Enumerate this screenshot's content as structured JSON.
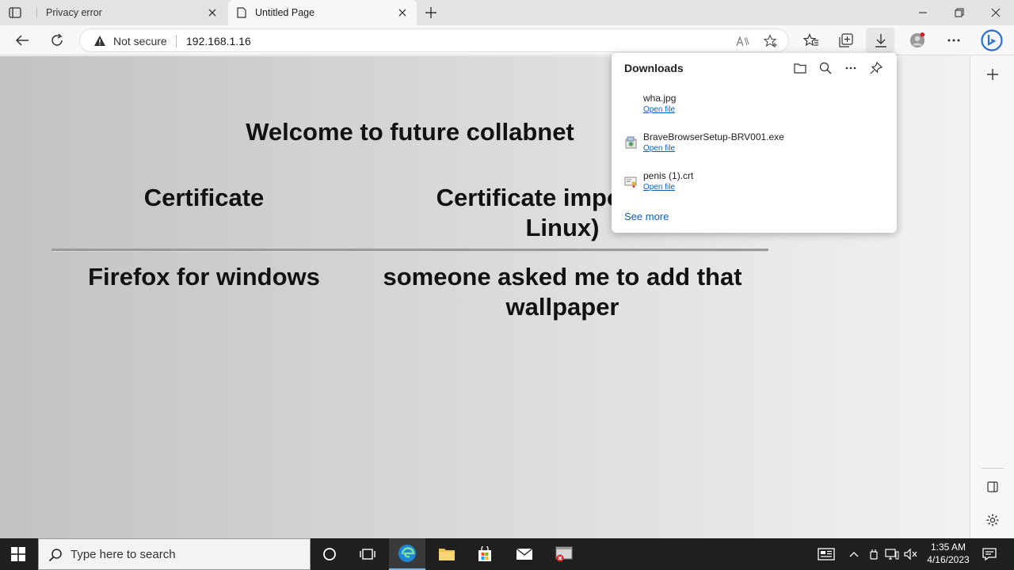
{
  "tabs": [
    {
      "title": "Privacy error",
      "active": false
    },
    {
      "title": "Untitled Page",
      "active": true
    }
  ],
  "addressbar": {
    "security_label": "Not secure",
    "url": "192.168.1.16"
  },
  "page": {
    "welcome": "Welcome to future collabnet",
    "certificate": "Certificate",
    "certificate_import_line1": "Certificate import bas",
    "certificate_import_line2": "Linux)",
    "firefox": "Firefox for windows",
    "someone_line1": "someone asked me to add that",
    "someone_line2": "wallpaper"
  },
  "downloads": {
    "title": "Downloads",
    "items": [
      {
        "name": "wha.jpg",
        "action": "Open file",
        "icon": "blank-file-icon"
      },
      {
        "name": "BraveBrowserSetup-BRV001.exe",
        "action": "Open file",
        "icon": "installer-file-icon"
      },
      {
        "name": "penis (1).crt",
        "action": "Open file",
        "icon": "certificate-file-icon"
      }
    ],
    "see_more": "See more"
  },
  "taskbar": {
    "search_placeholder": "Type here to search",
    "time": "1:35 AM",
    "date": "4/16/2023"
  },
  "colors": {
    "link": "#0c5fbf",
    "taskbar": "#1f1f1f",
    "accent": "#76b9ed"
  }
}
